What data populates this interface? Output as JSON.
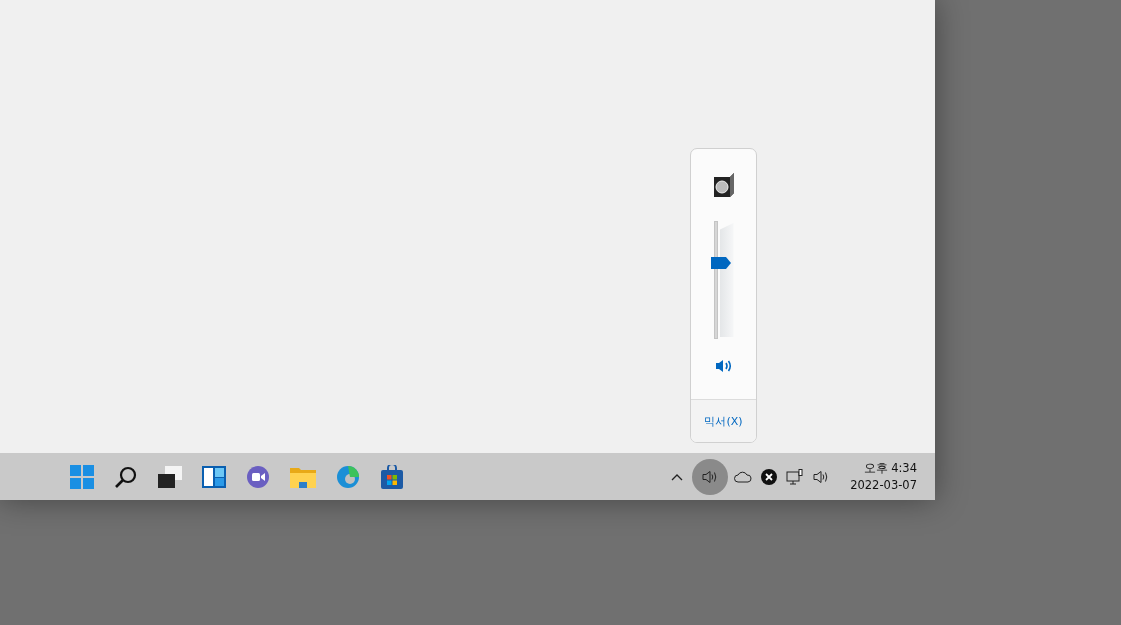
{
  "volume_popup": {
    "level": 0.66,
    "mixer_link": "믹서(X)"
  },
  "tray": [
    {
      "kind": "chevron",
      "hovered": false
    },
    {
      "kind": "volume",
      "hovered": true
    },
    {
      "kind": "cloud",
      "hovered": false
    },
    {
      "kind": "error",
      "hovered": false
    },
    {
      "kind": "network",
      "hovered": false
    },
    {
      "kind": "volume",
      "hovered": false
    }
  ],
  "clock": {
    "time": "오후 4:34",
    "date": "2022-03-07"
  }
}
